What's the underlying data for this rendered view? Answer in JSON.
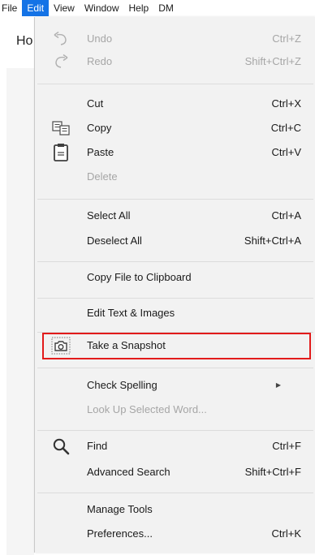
{
  "menubar": {
    "items": [
      {
        "label": "File"
      },
      {
        "label": "Edit"
      },
      {
        "label": "View"
      },
      {
        "label": "Window"
      },
      {
        "label": "Help"
      },
      {
        "label": "DM"
      }
    ]
  },
  "background": {
    "title_fragment": "Ho"
  },
  "edit_menu": {
    "undo": {
      "label": "Undo",
      "shortcut": "Ctrl+Z",
      "enabled": false
    },
    "redo": {
      "label": "Redo",
      "shortcut": "Shift+Ctrl+Z",
      "enabled": false
    },
    "cut": {
      "label": "Cut",
      "shortcut": "Ctrl+X"
    },
    "copy": {
      "label": "Copy",
      "shortcut": "Ctrl+C"
    },
    "paste": {
      "label": "Paste",
      "shortcut": "Ctrl+V"
    },
    "delete": {
      "label": "Delete",
      "enabled": false
    },
    "select_all": {
      "label": "Select All",
      "shortcut": "Ctrl+A"
    },
    "deselect_all": {
      "label": "Deselect All",
      "shortcut": "Shift+Ctrl+A"
    },
    "copy_file": {
      "label": "Copy File to Clipboard"
    },
    "edit_text": {
      "label": "Edit Text & Images"
    },
    "snapshot": {
      "label": "Take a Snapshot",
      "highlighted": true
    },
    "check_spelling": {
      "label": "Check Spelling",
      "has_submenu": true
    },
    "look_up": {
      "label": "Look Up Selected Word...",
      "enabled": false
    },
    "find": {
      "label": "Find",
      "shortcut": "Ctrl+F"
    },
    "advanced_search": {
      "label": "Advanced Search",
      "shortcut": "Shift+Ctrl+F"
    },
    "manage_tools": {
      "label": "Manage Tools"
    },
    "preferences": {
      "label": "Preferences...",
      "shortcut": "Ctrl+K"
    }
  },
  "icons": {
    "undo": "undo-arrow-icon",
    "redo": "redo-arrow-icon",
    "copy": "copy-icon",
    "paste": "clipboard-icon",
    "snapshot": "camera-snapshot-icon",
    "find": "magnifier-icon",
    "submenu": "submenu-arrow-icon"
  },
  "colors": {
    "active_menu": "#1473e6",
    "highlight_box": "#e21b1b",
    "menu_background": "#f2f2f2",
    "disabled_text": "#a6a6a6"
  }
}
